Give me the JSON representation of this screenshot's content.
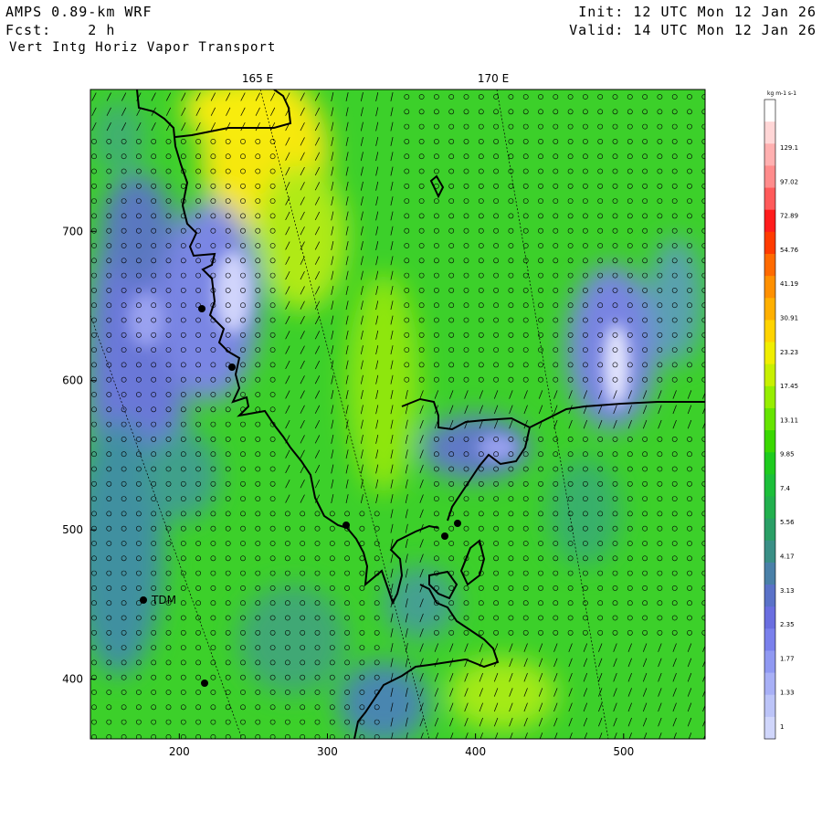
{
  "header": {
    "model": "AMPS 0.89-km WRF",
    "forecast_label": "Fcst:",
    "forecast_value": "2 h",
    "field": "Vert Intg Horiz Vapor Transport",
    "init": "Init: 12 UTC Mon 12 Jan 26",
    "valid": "Valid: 14 UTC Mon 12 Jan 26"
  },
  "map": {
    "longitude_labels": [
      "165 E",
      "170 E"
    ],
    "x_ticks": [
      "200",
      "300",
      "400",
      "500"
    ],
    "y_ticks": [
      "700",
      "600",
      "500",
      "400"
    ],
    "x_range": [
      140,
      555
    ],
    "y_range": [
      360,
      795
    ],
    "station_label": "TDM",
    "colors": {
      "low": "#6f7fe0",
      "mid": "#2ec82e",
      "high": "#f4e40a",
      "coast": "#000000"
    }
  },
  "colorbar": {
    "units": "kg m-1 s-1",
    "levels": [
      "129.1",
      "97.02",
      "72.89",
      "54.76",
      "41.19",
      "30.91",
      "23.23",
      "17.45",
      "13.11",
      "9.85",
      "7.4",
      "5.56",
      "4.17",
      "3.13",
      "2.35",
      "1.77",
      "1.33",
      "1"
    ],
    "colors": [
      "#ffffff",
      "#ffd6d6",
      "#ffb0b0",
      "#ff8c8c",
      "#ff5a5a",
      "#ff1c1c",
      "#ff3b00",
      "#ff6a00",
      "#ff9000",
      "#ffb000",
      "#ffd400",
      "#f0ee00",
      "#c8f000",
      "#96ee00",
      "#66e400",
      "#3ad800",
      "#1ecb1e",
      "#1cbf3a",
      "#22b04e",
      "#2a9f66",
      "#3a8f86",
      "#4a80a8",
      "#5a72c8",
      "#6a6ee0",
      "#7a80ec",
      "#9099f2",
      "#a8b0f6",
      "#bcc4f8",
      "#d0d6fb"
    ]
  }
}
